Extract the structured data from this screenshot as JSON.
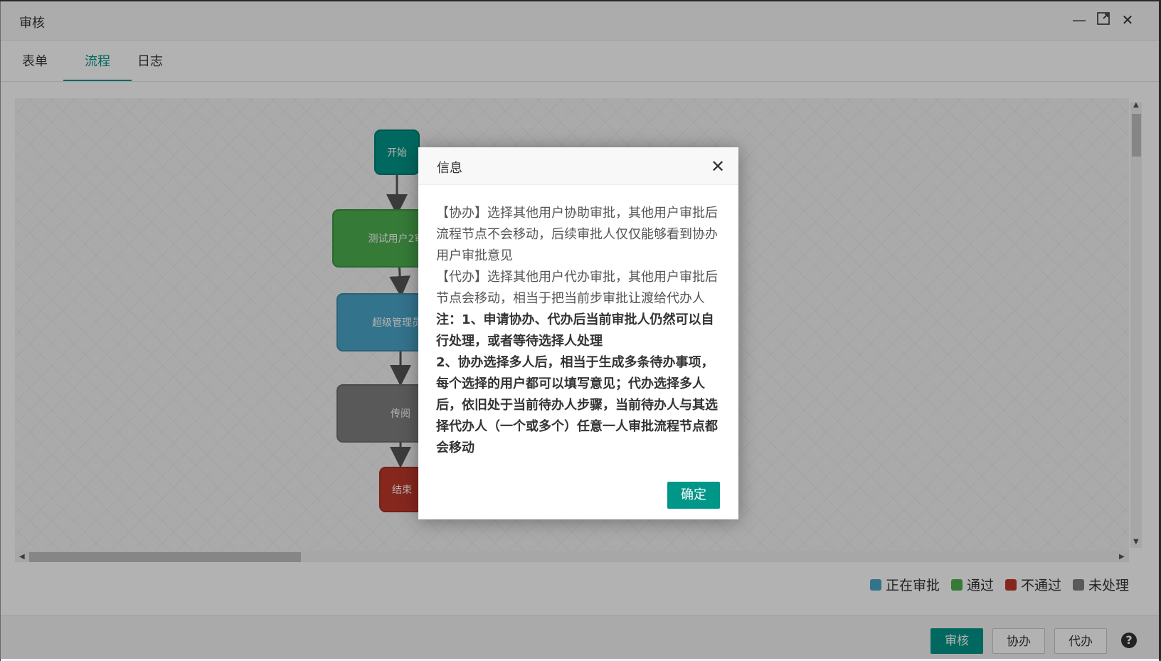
{
  "window": {
    "title": "审核"
  },
  "tabs": [
    {
      "label": "表单"
    },
    {
      "label": "流程"
    },
    {
      "label": "日志"
    }
  ],
  "flow": {
    "nodes": [
      {
        "label": "开始",
        "status": "start"
      },
      {
        "label": "测试用户2审",
        "status": "pass"
      },
      {
        "label": "超级管理员",
        "status": "in-progress"
      },
      {
        "label": "传阅",
        "status": "unprocessed"
      },
      {
        "label": "结束",
        "status": "end"
      }
    ]
  },
  "legend": [
    {
      "label": "正在审批",
      "color": "#4aa5c9"
    },
    {
      "label": "通过",
      "color": "#4caf50"
    },
    {
      "label": "不通过",
      "color": "#c0392b"
    },
    {
      "label": "未处理",
      "color": "#808080"
    }
  ],
  "footer": {
    "approve_label": "审核",
    "assist_label": "协办",
    "delegate_label": "代办",
    "help_glyph": "?"
  },
  "dialog": {
    "title": "信息",
    "para1": "【协办】选择其他用户协助审批，其他用户审批后流程节点不会移动，后续审批人仅仅能够看到协办用户审批意见",
    "para2": "【代办】选择其他用户代办审批，其他用户审批后节点会移动，相当于把当前步审批让渡给代办人",
    "note1": "注：1、申请协办、代办后当前审批人仍然可以自行处理，或者等待选择人处理",
    "note2": "2、协办选择多人后，相当于生成多条待办事项，每个选择的用户都可以填写意见；代办选择多人后，依旧处于当前待办人步骤，当前待办人与其选择代办人（一个或多个）任意一人审批流程节点都会移动",
    "confirm_label": "确定"
  }
}
